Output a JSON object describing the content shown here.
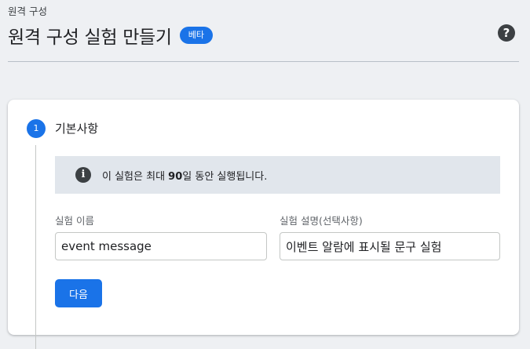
{
  "header": {
    "breadcrumb": "원격 구성",
    "title": "원격 구성 실험 만들기",
    "badge": "베타",
    "help_icon_glyph": "?"
  },
  "step": {
    "number": "1",
    "title": "기본사항",
    "info": {
      "icon_glyph": "i",
      "text_before": "이 실험은 최대 ",
      "text_bold": "90",
      "text_after": "일 동안 실행됩니다."
    },
    "fields": {
      "name_label": "실험 이름",
      "name_value": "event message",
      "description_label": "실험 설명(선택사항)",
      "description_value": "이벤트 알람에 표시될 문구 실험"
    },
    "next_button": "다음"
  },
  "colors": {
    "accent": "#1a73e8",
    "info_background": "#e1e6ec",
    "page_background": "#eef0f3"
  }
}
